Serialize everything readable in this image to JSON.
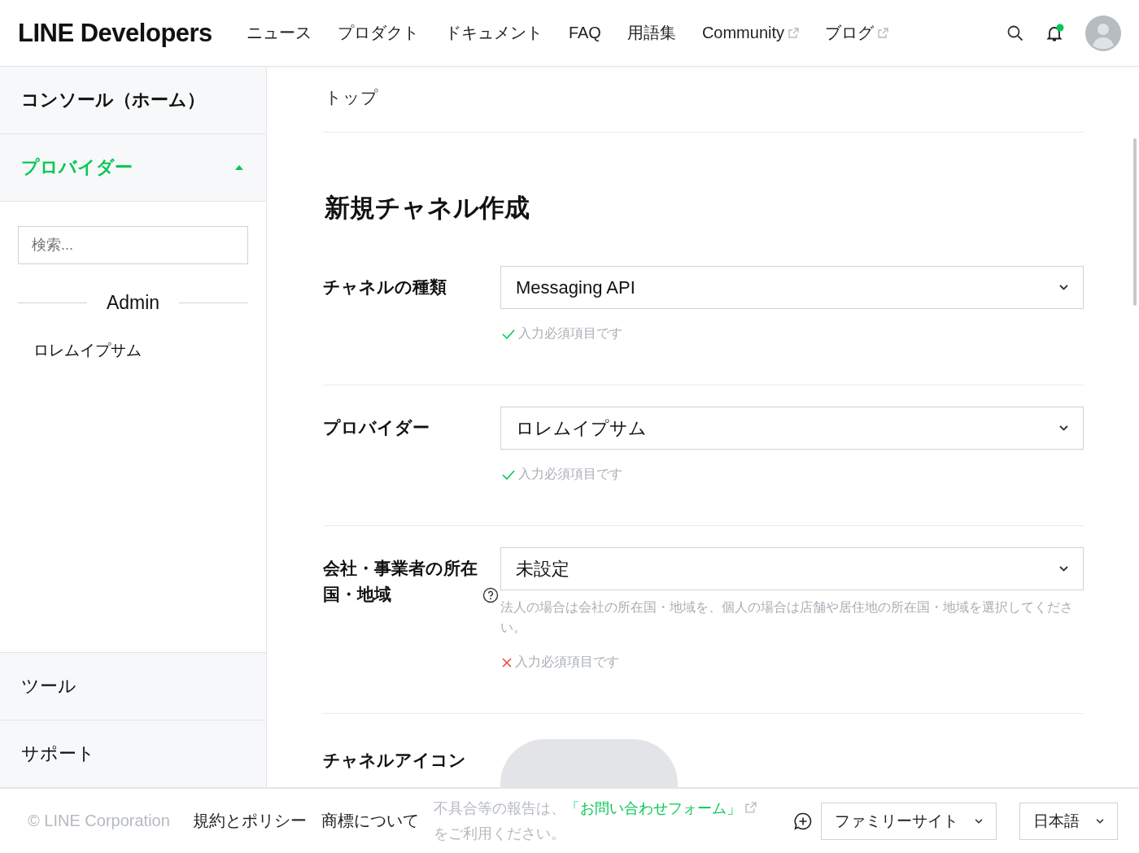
{
  "header": {
    "logo": "LINE Developers",
    "nav": [
      {
        "label": "ニュース",
        "external": false
      },
      {
        "label": "プロダクト",
        "external": false
      },
      {
        "label": "ドキュメント",
        "external": false
      },
      {
        "label": "FAQ",
        "external": false
      },
      {
        "label": "用語集",
        "external": false
      },
      {
        "label": "Community",
        "external": true
      },
      {
        "label": "ブログ",
        "external": true
      }
    ],
    "notification_dot": true
  },
  "sidebar": {
    "home": "コンソール（ホーム）",
    "provider": {
      "label": "プロバイダー",
      "expanded": true
    },
    "search": {
      "placeholder": "検索..."
    },
    "group": "Admin",
    "items": [
      "ロレムイプサム"
    ],
    "bottom": [
      "ツール",
      "サポート"
    ]
  },
  "main": {
    "breadcrumb": "トップ",
    "title": "新規チャネル作成",
    "fields": [
      {
        "label": "チャネルの種類",
        "help": false,
        "value": "Messaging API",
        "valid": true,
        "message": "入力必須項目です"
      },
      {
        "label": "プロバイダー",
        "help": false,
        "value": "ロレムイプサム",
        "valid": true,
        "message": "入力必須項目です"
      },
      {
        "label": "会社・事業者の所在国・地域",
        "help": true,
        "value": "未設定",
        "hint": "法人の場合は会社の所在国・地域を、個人の場合は店舗や居住地の所在国・地域を選択してください。",
        "valid": false,
        "message": "入力必須項目です"
      }
    ],
    "icon_field": {
      "label": "チャネルアイコン"
    }
  },
  "footer": {
    "copyright": "© LINE Corporation",
    "links": [
      "規約とポリシー",
      "商標について"
    ],
    "notice_before": "不具合等の報告は、",
    "notice_link": "「お問い合わせフォーム」",
    "notice_after": "をご利用ください。",
    "family_site": "ファミリーサイト",
    "language": "日本語"
  }
}
